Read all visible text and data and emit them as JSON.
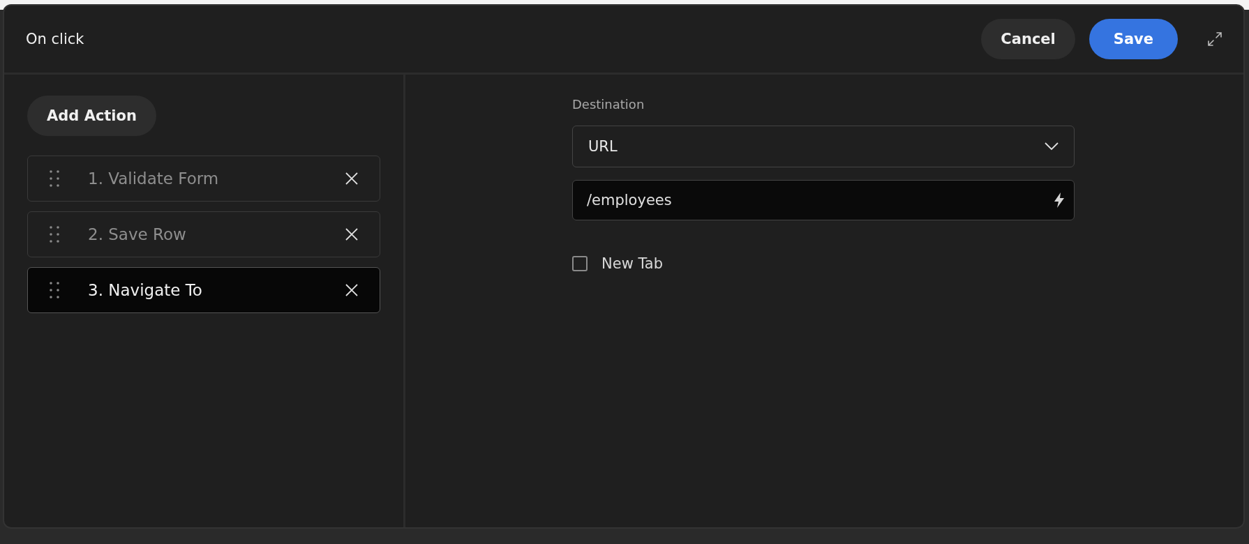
{
  "dialog": {
    "title": "On click",
    "buttons": {
      "cancel": "Cancel",
      "save": "Save"
    }
  },
  "actions_panel": {
    "add_button": "Add Action",
    "items": [
      {
        "label": "1. Validate Form",
        "selected": false
      },
      {
        "label": "2. Save Row",
        "selected": false
      },
      {
        "label": "3. Navigate To",
        "selected": true
      }
    ]
  },
  "settings": {
    "destination_label": "Destination",
    "destination_select": "URL",
    "url_field": "/employees",
    "new_tab": {
      "label": "New Tab",
      "checked": false
    }
  }
}
